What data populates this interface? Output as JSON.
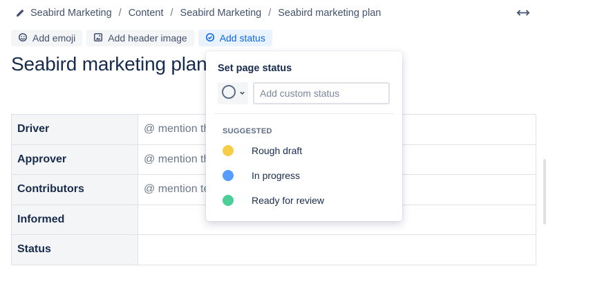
{
  "breadcrumb": {
    "items": [
      "Seabird Marketing",
      "Content",
      "Seabird Marketing",
      "Seabird marketing plan"
    ],
    "separator": "/"
  },
  "toolbar": {
    "add_emoji": "Add emoji",
    "add_header_image": "Add header image",
    "add_status": "Add status"
  },
  "page": {
    "title": "Seabird marketing plan"
  },
  "table": {
    "rows": [
      {
        "label": "Driver",
        "value": "@ mention th"
      },
      {
        "label": "Approver",
        "value": "@ mention th"
      },
      {
        "label": "Contributors",
        "value": "@ mention te"
      },
      {
        "label": "Informed",
        "value": ""
      },
      {
        "label": "Status",
        "value": ""
      }
    ]
  },
  "status_popup": {
    "title": "Set page status",
    "input_placeholder": "Add custom status",
    "suggested_label": "SUGGESTED",
    "options": [
      {
        "label": "Rough draft",
        "color": "#f5cd47"
      },
      {
        "label": "In progress",
        "color": "#579dff"
      },
      {
        "label": "Ready for review",
        "color": "#4bce97"
      }
    ]
  },
  "icons": {
    "breadcrumb": "pencil-icon",
    "expand": "expand-width-icon",
    "emoji": "smiley-icon",
    "header_image": "image-icon",
    "status": "check-circle-icon",
    "picker": "empty-circle-icon"
  },
  "colors": {
    "accent": "#0c66e4",
    "accent_bg": "#e9f2ff",
    "table_header_bg": "#f4f5f7"
  }
}
